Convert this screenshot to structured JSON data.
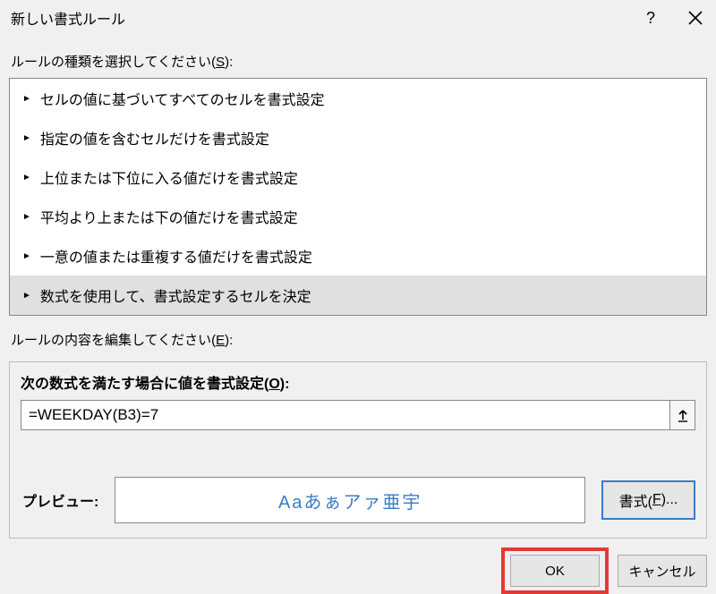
{
  "titlebar": {
    "title": "新しい書式ルール",
    "help": "?",
    "close": "×"
  },
  "ruleType": {
    "label_pre": "ルールの種類を選択してください(",
    "label_u": "S",
    "label_post": "):",
    "items": [
      "セルの値に基づいてすべてのセルを書式設定",
      "指定の値を含むセルだけを書式設定",
      "上位または下位に入る値だけを書式設定",
      "平均より上または下の値だけを書式設定",
      "一意の値または重複する値だけを書式設定",
      "数式を使用して、書式設定するセルを決定"
    ],
    "selectedIndex": 5
  },
  "ruleEdit": {
    "label_pre": "ルールの内容を編集してください(",
    "label_u": "E",
    "label_post": "):",
    "formula_label_pre": "次の数式を満たす場合に値を書式設定(",
    "formula_label_u": "O",
    "formula_label_post": "):",
    "formula_value": "=WEEKDAY(B3)=7",
    "collapse": "↑",
    "preview_label": "プレビュー:",
    "preview_text": "Aaあぁアァ亜宇",
    "format_btn_pre": "書式(",
    "format_btn_u": "F",
    "format_btn_post": ")..."
  },
  "footer": {
    "ok": "OK",
    "cancel": "キャンセル"
  }
}
